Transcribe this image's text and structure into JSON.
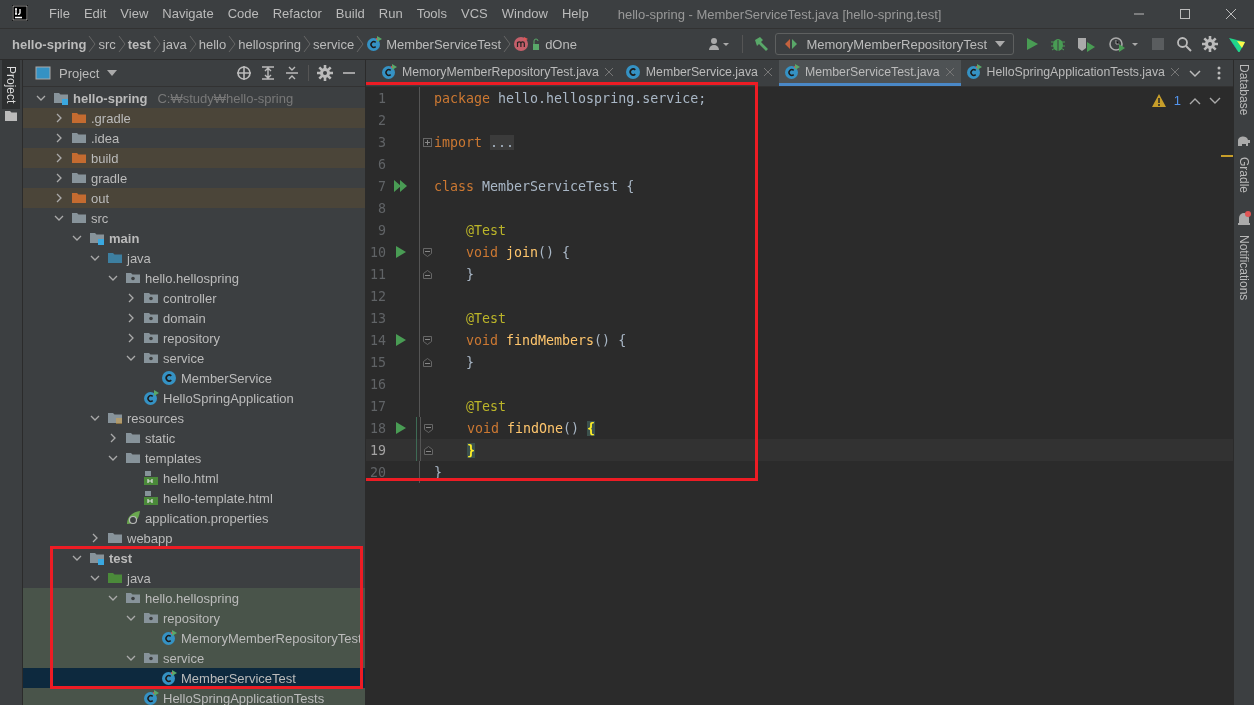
{
  "window": {
    "title": "hello-spring - MemberServiceTest.java [hello-spring.test]"
  },
  "menu": [
    "File",
    "Edit",
    "View",
    "Navigate",
    "Code",
    "Refactor",
    "Build",
    "Run",
    "Tools",
    "VCS",
    "Window",
    "Help"
  ],
  "breadcrumbs": [
    {
      "label": "hello-spring",
      "kind": "module"
    },
    {
      "label": "src",
      "kind": "dir"
    },
    {
      "label": "test",
      "kind": "module"
    },
    {
      "label": "java",
      "kind": "dir"
    },
    {
      "label": "hello",
      "kind": "dir"
    },
    {
      "label": "hellospring",
      "kind": "dir"
    },
    {
      "label": "service",
      "kind": "dir"
    },
    {
      "label": "MemberServiceTest",
      "kind": "class"
    },
    {
      "label": "dOne",
      "kind": "method"
    }
  ],
  "run_config": {
    "label": "MemoryMemberRepositoryTest"
  },
  "left_strip": [
    {
      "label": "Project",
      "selected": true
    }
  ],
  "project_panel": {
    "title": "Project",
    "tree": [
      {
        "label": "hello-spring",
        "kind": "module",
        "hint": "C:₩study₩hello-spring",
        "expanded": true,
        "selected": false,
        "children": [
          {
            "label": ".gradle",
            "kind": "folder-excluded",
            "expanded": false,
            "selected": false
          },
          {
            "label": ".idea",
            "kind": "folder",
            "expanded": false,
            "selected": false
          },
          {
            "label": "build",
            "kind": "folder-excluded",
            "expanded": false,
            "selected": false
          },
          {
            "label": "gradle",
            "kind": "folder",
            "expanded": false,
            "selected": false
          },
          {
            "label": "out",
            "kind": "folder-excluded",
            "expanded": false,
            "selected": false
          },
          {
            "label": "src",
            "kind": "folder",
            "expanded": true,
            "selected": false,
            "children": [
              {
                "label": "main",
                "kind": "module",
                "expanded": true,
                "selected": false,
                "children": [
                  {
                    "label": "java",
                    "kind": "source-root",
                    "expanded": true,
                    "selected": false,
                    "children": [
                      {
                        "label": "hello.hellospring",
                        "kind": "package",
                        "expanded": true,
                        "selected": false,
                        "children": [
                          {
                            "label": "controller",
                            "kind": "package",
                            "expanded": false,
                            "selected": false
                          },
                          {
                            "label": "domain",
                            "kind": "package",
                            "expanded": false,
                            "selected": false
                          },
                          {
                            "label": "repository",
                            "kind": "package",
                            "expanded": false,
                            "selected": false
                          },
                          {
                            "label": "service",
                            "kind": "package",
                            "expanded": true,
                            "selected": false,
                            "children": [
                              {
                                "label": "MemberService",
                                "kind": "class",
                                "selected": false
                              }
                            ]
                          },
                          {
                            "label": "HelloSpringApplication",
                            "kind": "spring-class",
                            "selected": false
                          }
                        ]
                      }
                    ]
                  },
                  {
                    "label": "resources",
                    "kind": "resources",
                    "expanded": true,
                    "selected": false,
                    "children": [
                      {
                        "label": "static",
                        "kind": "folder",
                        "expanded": false,
                        "selected": false
                      },
                      {
                        "label": "templates",
                        "kind": "folder",
                        "expanded": true,
                        "selected": false,
                        "children": [
                          {
                            "label": "hello.html",
                            "kind": "html",
                            "selected": false
                          },
                          {
                            "label": "hello-template.html",
                            "kind": "html",
                            "selected": false
                          }
                        ]
                      },
                      {
                        "label": "application.properties",
                        "kind": "properties",
                        "selected": false
                      }
                    ]
                  },
                  {
                    "label": "webapp",
                    "kind": "folder",
                    "expanded": false,
                    "selected": false
                  }
                ]
              },
              {
                "label": "test",
                "kind": "module",
                "expanded": true,
                "selected": false,
                "highlighted": true,
                "children": [
                  {
                    "label": "java",
                    "kind": "test-root",
                    "expanded": true,
                    "selected": false,
                    "highlighted": true,
                    "children": [
                      {
                        "label": "hello.hellospring",
                        "kind": "package",
                        "expanded": true,
                        "selected": false,
                        "highlighted": true,
                        "children": [
                          {
                            "label": "repository",
                            "kind": "package",
                            "expanded": true,
                            "selected": false,
                            "highlighted": true,
                            "children": [
                              {
                                "label": "MemoryMemberRepositoryTest",
                                "kind": "test-class",
                                "selected": false,
                                "highlighted": true
                              }
                            ]
                          },
                          {
                            "label": "service",
                            "kind": "package",
                            "expanded": true,
                            "selected": false,
                            "highlighted": true,
                            "children": [
                              {
                                "label": "MemberServiceTest",
                                "kind": "test-class",
                                "selected": true,
                                "highlighted": true
                              }
                            ]
                          },
                          {
                            "label": "HelloSpringApplicationTests",
                            "kind": "test-class",
                            "selected": false
                          }
                        ]
                      }
                    ]
                  }
                ]
              }
            ]
          }
        ]
      }
    ]
  },
  "tabs": [
    {
      "label": "MemoryMemberRepositoryTest.java",
      "kind": "test-class",
      "selected": false
    },
    {
      "label": "MemberService.java",
      "kind": "class",
      "selected": false
    },
    {
      "label": "MemberServiceTest.java",
      "kind": "test-class",
      "selected": true
    },
    {
      "label": "HelloSpringApplicationTests.java",
      "kind": "test-class",
      "selected": false
    }
  ],
  "editor": {
    "highlight_frame": true,
    "warnings": "1",
    "lines": [
      {
        "number": "1",
        "current": false,
        "modified": false,
        "tokens": [
          {
            "kind": "keyword",
            "text": "package"
          },
          {
            "kind": "plain",
            "text": " hello.hellospring.service;"
          }
        ]
      },
      {
        "number": "2",
        "current": false,
        "modified": false
      },
      {
        "number": "3",
        "current": false,
        "modified": false,
        "fold": {
          "kind": "collapsed"
        },
        "tokens": [
          {
            "kind": "keyword",
            "text": "import"
          },
          {
            "kind": "folded",
            "text": "..."
          }
        ]
      },
      {
        "number": "6",
        "current": false,
        "modified": false
      },
      {
        "number": "7",
        "current": false,
        "modified": false,
        "gutter_icon": {
          "kind": "run-class"
        },
        "tokens": [
          {
            "kind": "keyword",
            "text": "class"
          },
          {
            "kind": "plain",
            "text": " MemberServiceTest {"
          }
        ]
      },
      {
        "number": "8",
        "current": false,
        "modified": false
      },
      {
        "number": "9",
        "current": false,
        "modified": false,
        "indented": true,
        "tokens": [
          {
            "kind": "annotation",
            "text": "@Test"
          }
        ]
      },
      {
        "number": "10",
        "current": false,
        "modified": false,
        "indented": true,
        "gutter_icon": {
          "kind": "run"
        },
        "fold": {
          "kind": "open"
        },
        "tokens": [
          {
            "kind": "keyword",
            "text": "void"
          },
          {
            "kind": "method",
            "text": " join"
          },
          {
            "kind": "plain",
            "text": "() {"
          }
        ]
      },
      {
        "number": "11",
        "current": false,
        "modified": false,
        "indented": true,
        "fold": {
          "kind": "close"
        },
        "tokens": [
          {
            "kind": "plain",
            "text": "}"
          }
        ]
      },
      {
        "number": "12",
        "current": false,
        "modified": false
      },
      {
        "number": "13",
        "current": false,
        "modified": false,
        "indented": true,
        "tokens": [
          {
            "kind": "annotation",
            "text": "@Test"
          }
        ]
      },
      {
        "number": "14",
        "current": false,
        "modified": false,
        "indented": true,
        "gutter_icon": {
          "kind": "run"
        },
        "fold": {
          "kind": "open"
        },
        "tokens": [
          {
            "kind": "keyword",
            "text": "void"
          },
          {
            "kind": "method",
            "text": " findMembers"
          },
          {
            "kind": "plain",
            "text": "() {"
          }
        ]
      },
      {
        "number": "15",
        "current": false,
        "modified": false,
        "indented": true,
        "fold": {
          "kind": "close"
        },
        "tokens": [
          {
            "kind": "plain",
            "text": "}"
          }
        ]
      },
      {
        "number": "16",
        "current": false,
        "modified": false
      },
      {
        "number": "17",
        "current": false,
        "modified": false,
        "indented": true,
        "tokens": [
          {
            "kind": "annotation",
            "text": "@Test"
          }
        ]
      },
      {
        "number": "18",
        "current": false,
        "modified": true,
        "indented": true,
        "gutter_icon": {
          "kind": "run"
        },
        "fold": {
          "kind": "open"
        },
        "tokens": [
          {
            "kind": "keyword",
            "text": "void"
          },
          {
            "kind": "method",
            "text": " findOne"
          },
          {
            "kind": "plain",
            "text": "() "
          },
          {
            "kind": "brace-match",
            "text": "{"
          }
        ]
      },
      {
        "number": "19",
        "current": true,
        "modified": true,
        "indented": true,
        "fold": {
          "kind": "close"
        },
        "tokens": [
          {
            "kind": "brace-match",
            "text": "}"
          }
        ]
      },
      {
        "number": "20",
        "current": false,
        "modified": false,
        "tokens": [
          {
            "kind": "plain",
            "text": "}"
          }
        ]
      }
    ]
  },
  "right_strip": [
    {
      "label": "Database",
      "kind": "plain"
    },
    {
      "label": "Gradle",
      "kind": "elephant"
    },
    {
      "label": "Notifications",
      "kind": "bell"
    }
  ]
}
